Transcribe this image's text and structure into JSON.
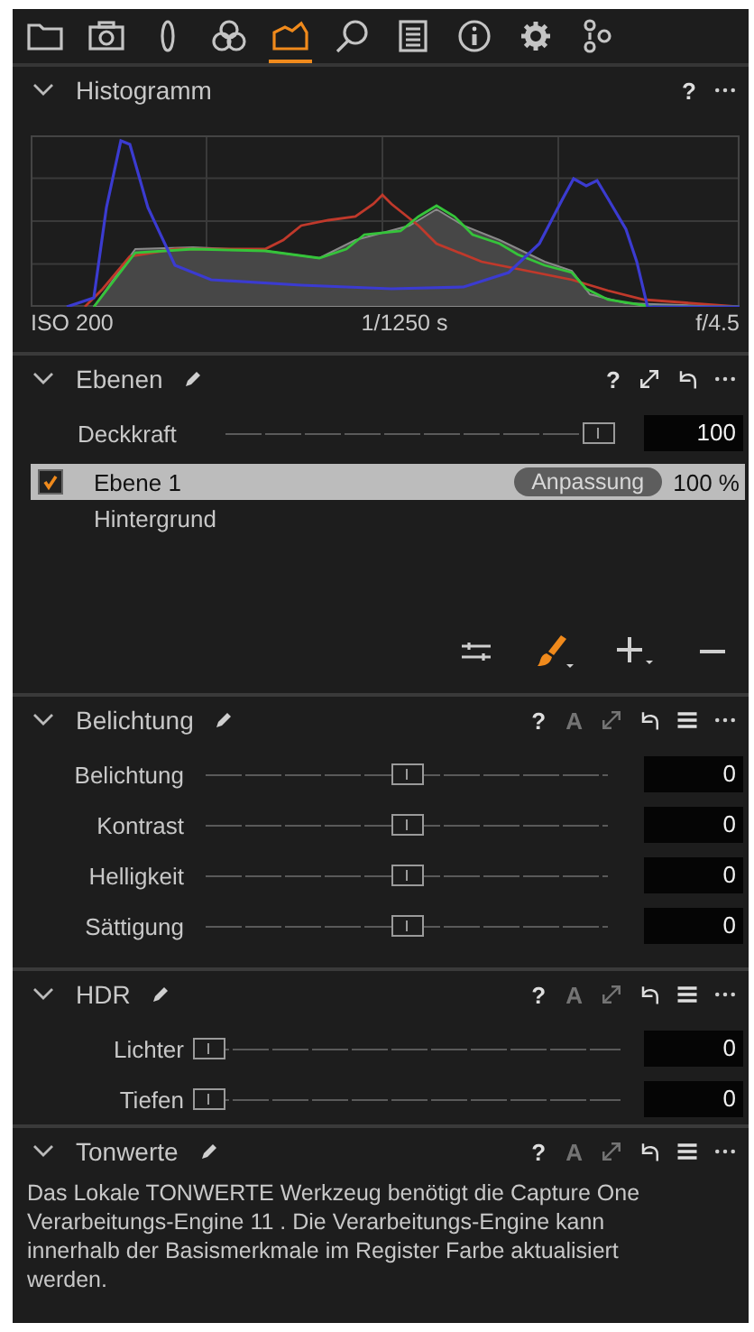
{
  "tabs": [
    {
      "kind": "folder",
      "selected": false
    },
    {
      "kind": "camera",
      "selected": false
    },
    {
      "kind": "lens",
      "selected": false
    },
    {
      "kind": "color",
      "selected": false
    },
    {
      "kind": "exposure",
      "selected": true
    },
    {
      "kind": "search",
      "selected": false
    },
    {
      "kind": "list",
      "selected": false
    },
    {
      "kind": "info",
      "selected": false
    },
    {
      "kind": "gear",
      "selected": false
    },
    {
      "kind": "gears",
      "selected": false
    }
  ],
  "sections": [
    {
      "kind": "histogram",
      "title": "Histogramm",
      "pencil": false,
      "actions": [
        {
          "kind": "help",
          "text": "?",
          "disabled": false
        },
        {
          "kind": "more",
          "disabled": false
        }
      ],
      "iso": "ISO 200",
      "shutter": "1/1250 s",
      "aperture": "f/4.5"
    },
    {
      "kind": "layers",
      "title": "Ebenen",
      "pencil": true,
      "actions": [
        {
          "kind": "help",
          "text": "?",
          "disabled": false
        },
        {
          "kind": "expand",
          "disabled": false
        },
        {
          "kind": "reset",
          "disabled": false
        },
        {
          "kind": "more",
          "disabled": false
        }
      ],
      "opacity": {
        "label": "Deckkraft",
        "level": 1,
        "value": "100"
      },
      "layers": [
        {
          "kind": "adjustment",
          "name": "Ebene 1",
          "checked": true,
          "selected": true,
          "badge": "Anpassung",
          "amount": "100 %"
        },
        {
          "kind": "background",
          "name": "Hintergrund",
          "selected": false
        }
      ],
      "tools": [
        {
          "kind": "swap"
        },
        {
          "kind": "brush"
        },
        {
          "kind": "add"
        },
        {
          "kind": "remove"
        }
      ]
    },
    {
      "kind": "sliders",
      "title": "Belichtung",
      "pencil": true,
      "actions": [
        {
          "kind": "help",
          "text": "?",
          "disabled": false
        },
        {
          "kind": "auto",
          "text": "A",
          "disabled": true
        },
        {
          "kind": "expand",
          "disabled": true
        },
        {
          "kind": "reset",
          "disabled": false
        },
        {
          "kind": "menu",
          "disabled": false
        },
        {
          "kind": "more",
          "disabled": false
        }
      ],
      "sliders": [
        {
          "label": "Belichtung",
          "level": 0.5,
          "value": "0"
        },
        {
          "label": "Kontrast",
          "level": 0.5,
          "value": "0"
        },
        {
          "label": "Helligkeit",
          "level": 0.5,
          "value": "0"
        },
        {
          "label": "Sättigung",
          "level": 0.5,
          "value": "0"
        }
      ]
    },
    {
      "kind": "sliders",
      "title": "HDR",
      "pencil": true,
      "actions": [
        {
          "kind": "help",
          "text": "?",
          "disabled": false
        },
        {
          "kind": "auto",
          "text": "A",
          "disabled": true
        },
        {
          "kind": "expand",
          "disabled": true
        },
        {
          "kind": "reset",
          "disabled": false
        },
        {
          "kind": "menu",
          "disabled": false
        },
        {
          "kind": "more",
          "disabled": false
        }
      ],
      "sliders": [
        {
          "label": "Lichter",
          "level": 0,
          "value": "0"
        },
        {
          "label": "Tiefen",
          "level": 0,
          "value": "0"
        }
      ]
    },
    {
      "kind": "message",
      "title": "Tonwerte",
      "pencil": true,
      "actions": [
        {
          "kind": "help",
          "text": "?",
          "disabled": false
        },
        {
          "kind": "auto",
          "text": "A",
          "disabled": true
        },
        {
          "kind": "expand",
          "disabled": true
        },
        {
          "kind": "reset",
          "disabled": false
        },
        {
          "kind": "menu",
          "disabled": false
        },
        {
          "kind": "more",
          "disabled": false
        }
      ],
      "text": "Das Lokale TONWERTE Werkzeug benötigt die Capture One Verarbeitungs-Engine 11 . Die Verarbeitungs-Engine kann innerhalb der Basismerkmale im Register Farbe aktualisiert werden."
    }
  ]
}
